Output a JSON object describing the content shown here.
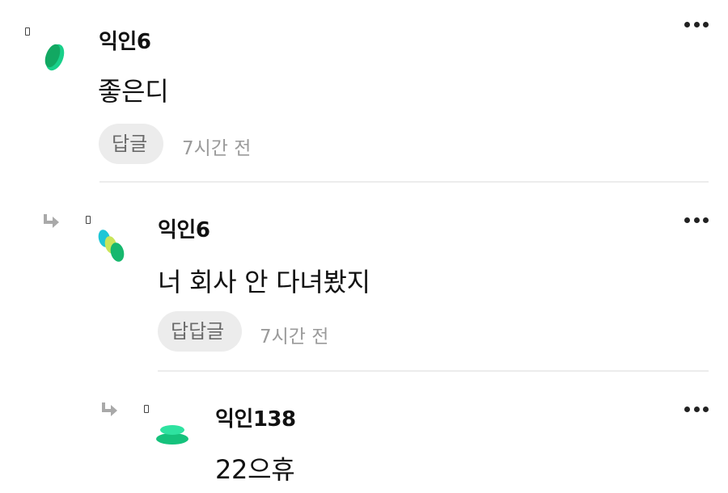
{
  "colors": {
    "avatar_green": "#22c07a",
    "avatar_teal": "#1ec6d6",
    "avatar_lime": "#c9e55a",
    "divider": "#ececec",
    "reply_bg": "#ececec",
    "meta_text": "#9a9a9a"
  },
  "comments": [
    {
      "author": "익인6",
      "text": "좋은디",
      "reply_label": "답글",
      "time": "7시간 전",
      "more_icon": "more-dots-icon",
      "avatar_icon": "green-pill-avatar-icon"
    },
    {
      "author": "익인6",
      "text": "너 회사 안 다녀봤지",
      "reply_label": "답답글",
      "time": "7시간 전",
      "more_icon": "more-dots-icon",
      "avatar_icon": "multicolor-pills-avatar-icon",
      "reply_arrow_icon": "reply-arrow-icon"
    },
    {
      "author": "익인138",
      "text": "22으휴",
      "more_icon": "more-dots-icon",
      "avatar_icon": "stacked-disc-avatar-icon",
      "reply_arrow_icon": "reply-arrow-icon"
    }
  ]
}
